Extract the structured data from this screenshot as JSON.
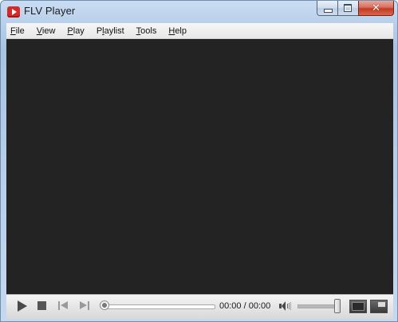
{
  "window": {
    "title": "FLV Player",
    "icon": "flv-player-app-icon"
  },
  "caption_buttons": {
    "minimize_icon": "minimize-icon",
    "maximize_icon": "maximize-icon",
    "close_icon": "close-icon",
    "close_glyph": "✕",
    "close_color": "#c23a22"
  },
  "menu": {
    "items": [
      {
        "label": "File",
        "mnemonic": "F"
      },
      {
        "label": "View",
        "mnemonic": "V"
      },
      {
        "label": "Play",
        "mnemonic": "P"
      },
      {
        "label": "Playlist",
        "mnemonic": "l"
      },
      {
        "label": "Tools",
        "mnemonic": "T"
      },
      {
        "label": "Help",
        "mnemonic": "H"
      }
    ]
  },
  "video": {
    "background_color": "#232323"
  },
  "controls": {
    "play_icon": "play-icon",
    "stop_icon": "stop-icon",
    "previous_icon": "previous-track-icon",
    "next_icon": "next-track-icon",
    "seek_progress": 0,
    "time_display": "00:00 / 00:00",
    "volume_icon": "speaker-icon",
    "volume_level": 1.0,
    "view_button_1_icon": "normal-view-icon",
    "view_button_2_icon": "compact-view-icon"
  }
}
